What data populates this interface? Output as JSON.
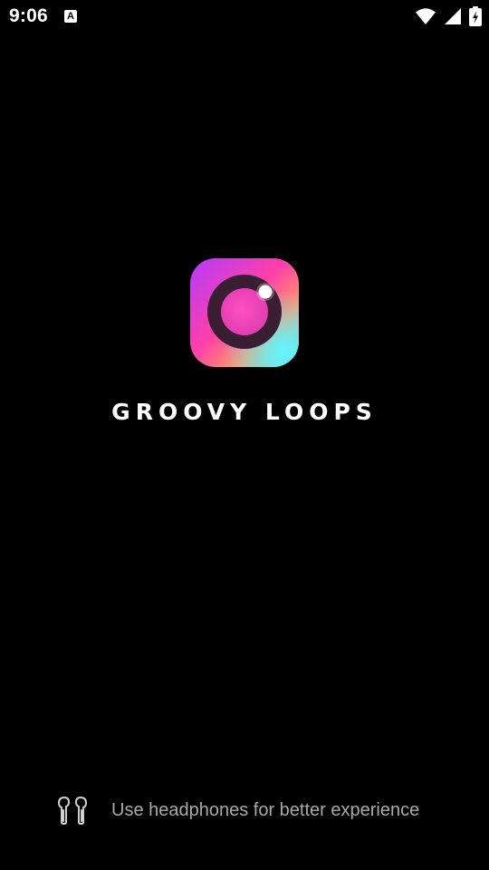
{
  "status_bar": {
    "time": "9:06",
    "notification_icon_letter": "A",
    "icons": [
      "wifi-icon",
      "cellular-signal-icon",
      "battery-charging-icon"
    ]
  },
  "splash": {
    "app_name": "GROOVY LOOPS",
    "logo_icon": "camera-lens-logo"
  },
  "footer": {
    "hint_icon": "earbuds-icon",
    "hint_text": "Use headphones for better experience"
  },
  "colors": {
    "background": "#000000",
    "title": "#ffffff",
    "hint_text": "#a9a9a9",
    "logo_gradient": [
      "#b23cff",
      "#ff3fa8",
      "#ff9a56",
      "#3ff0ff"
    ]
  }
}
